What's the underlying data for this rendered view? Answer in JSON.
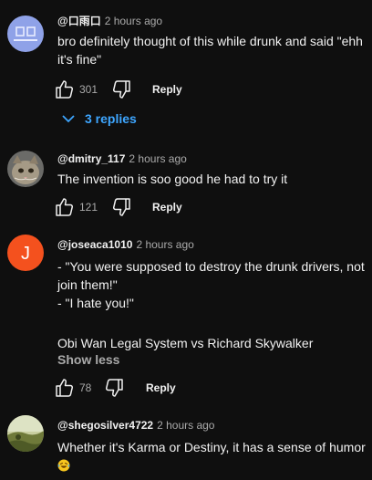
{
  "comments": [
    {
      "author": "@口雨口",
      "time": "2 hours ago",
      "lines": [
        "bro definitely thought of this while drunk and said \"ehh",
        "it's fine\""
      ],
      "likes": "301",
      "reply_label": "Reply",
      "replies_label": "3 replies"
    },
    {
      "author": "@dmitry_117",
      "time": "2 hours ago",
      "lines": [
        "The invention is soo good he had to try it"
      ],
      "likes": "121",
      "reply_label": "Reply"
    },
    {
      "author": "@joseaca1010",
      "time": "2 hours ago",
      "avatar_letter": "J",
      "avatar_color": "#f4511e",
      "lines": [
        "- \"You were supposed to destroy the drunk drivers, not",
        "join them!\"",
        "- \"I hate you!\"",
        "",
        "Obi Wan Legal System vs Richard Skywalker"
      ],
      "show_less_label": "Show less",
      "likes": "78",
      "reply_label": "Reply"
    },
    {
      "author": "@shegosilver4722",
      "time": "2 hours ago",
      "lines": [
        "Whether it's Karma or Destiny, it has a sense of humor"
      ],
      "emoji": "laughing-with-tears-emoji"
    }
  ],
  "colors": {
    "background": "#0f0f0f",
    "text": "#f1f1f1",
    "secondary_text": "#aaaaaa",
    "link": "#3ea6ff"
  },
  "icons": [
    "thumbs-up-icon",
    "thumbs-down-icon",
    "chevron-down-icon"
  ]
}
